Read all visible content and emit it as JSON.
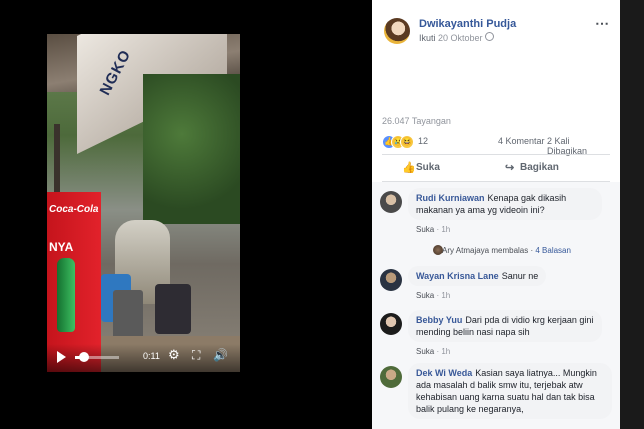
{
  "video": {
    "cooler_brand": "Coca-Cola",
    "cooler_text": "NYA",
    "sign_text": "NGKO",
    "time": "0:11",
    "progress_fraction": 0.2
  },
  "post": {
    "author": "Dwikayanthi Pudja",
    "follow_label": "Ikuti",
    "date": "20 Oktober",
    "views": "26.047 Tayangan",
    "reactions_total": "12",
    "comments_count": "4 Komentar",
    "shares_count": "2 Kali Dibagikan",
    "like_label": "Suka",
    "share_label": "Bagikan"
  },
  "comments": [
    {
      "name": "Rudi Kurniawan",
      "text": "Kenapa gak dikasih makanan ya ama yg videoin ini?",
      "reply_label": "Suka",
      "time": "1h"
    },
    {
      "name": "Wayan Krisna Lane",
      "text": "Sanur ne",
      "reply_label": "Suka",
      "time": "1h"
    },
    {
      "name": "Bebby Yuu",
      "text": "Dari pda di vidio krg kerjaan gini mending beliin nasi napa sih",
      "reply_label": "Suka",
      "time": "1h"
    },
    {
      "name": "Dek Wi Weda",
      "text": "Kasian saya liatnya... Mungkin ada masalah d balik smw itu, terjebak atw kehabisan uang karna suatu hal dan tak bisa balik pulang ke negaranya,"
    }
  ],
  "reply_thread": {
    "text": "Ary Atmajaya membalas",
    "count": "4 Balasan"
  },
  "colors": {
    "link": "#365899",
    "like": "#5890ff",
    "cooler": "#e2222b"
  }
}
